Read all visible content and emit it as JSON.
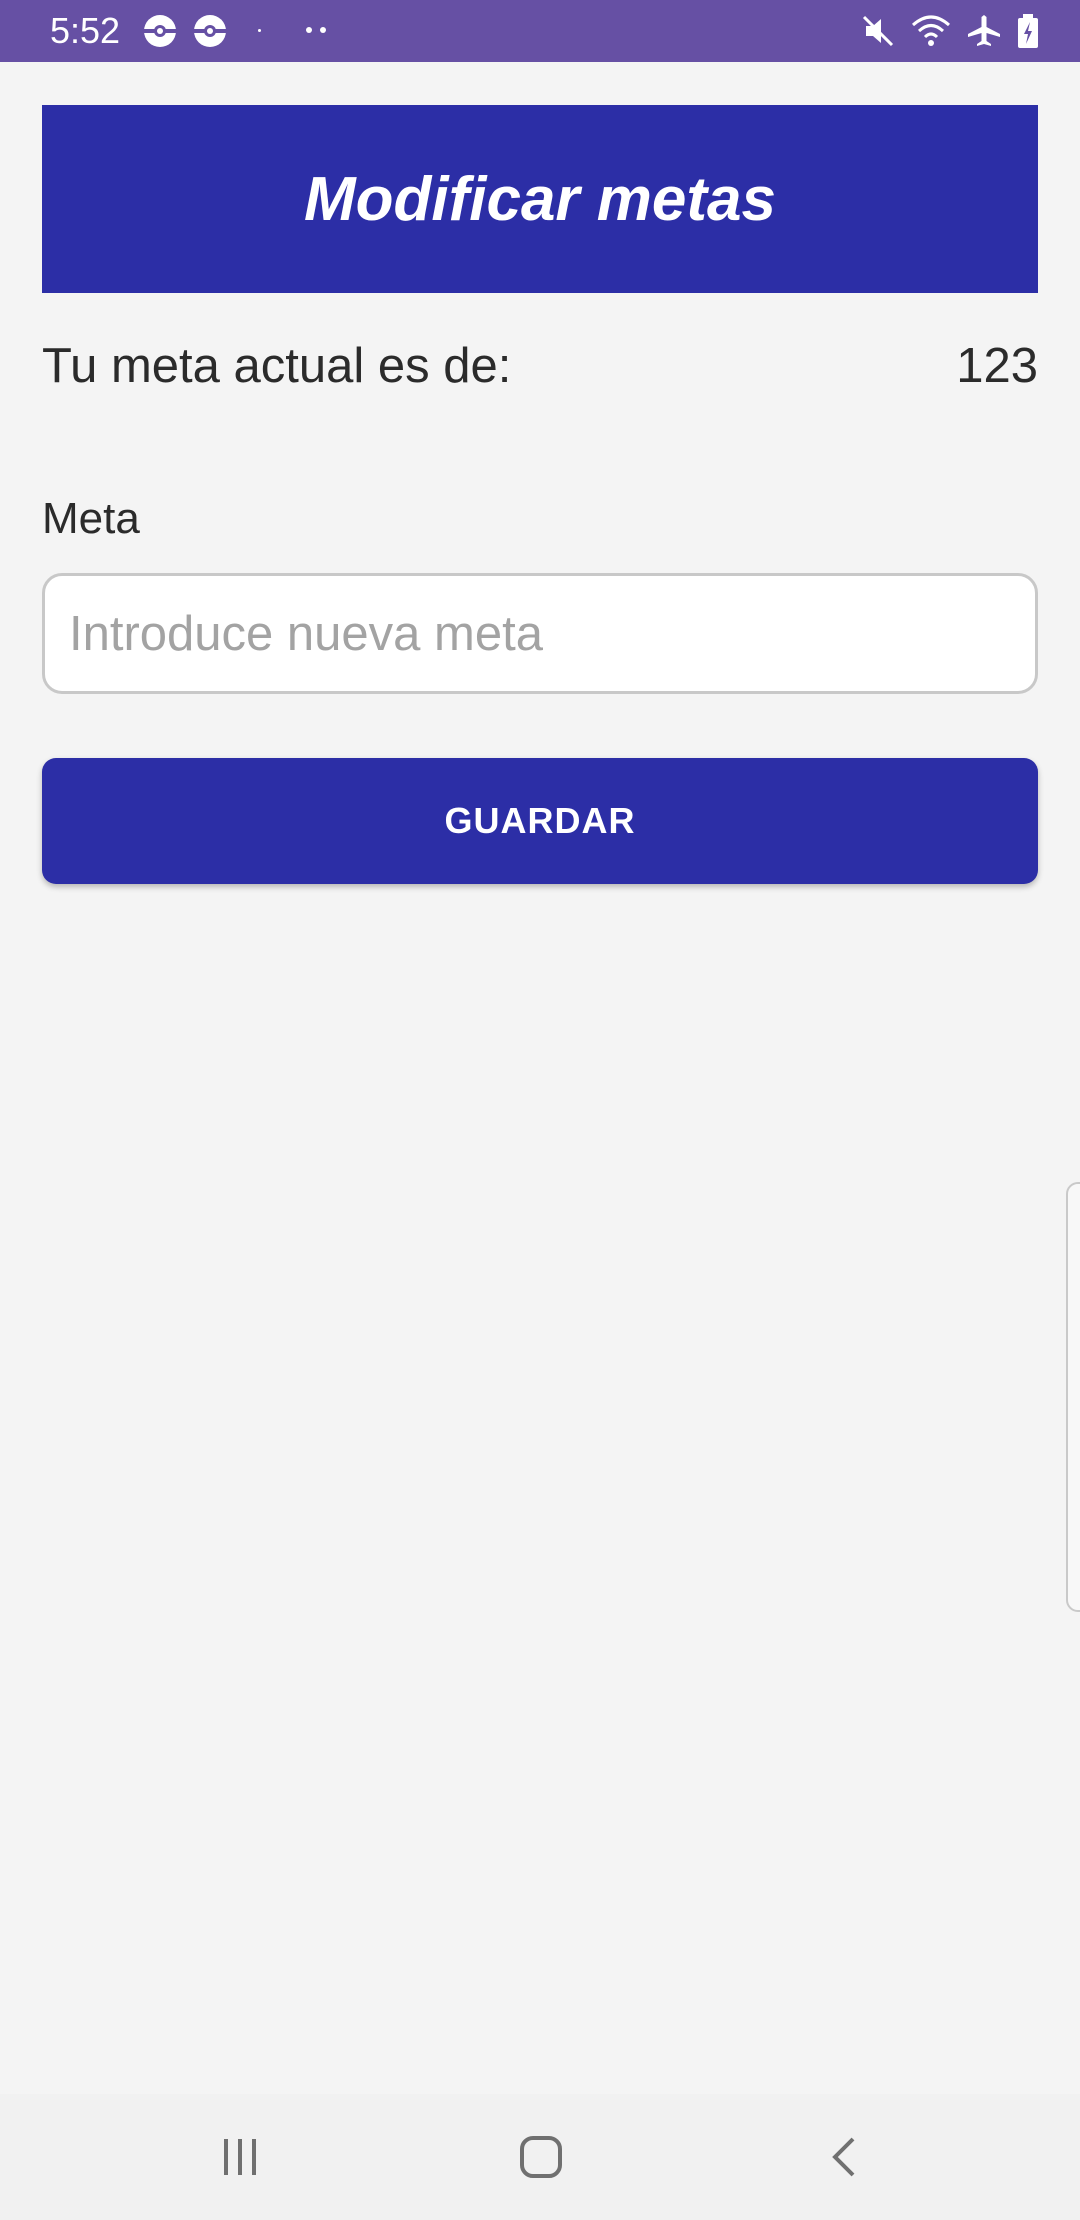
{
  "status_bar": {
    "time": "5:52",
    "icons": [
      "pokeball-icon",
      "pokeball-icon",
      "dots-icon",
      "mute-icon",
      "wifi-icon",
      "airplane-icon",
      "battery-charging-icon"
    ]
  },
  "header": {
    "title": "Modificar metas"
  },
  "current_goal": {
    "label": "Tu meta actual es de:",
    "value": "123"
  },
  "goal_field": {
    "label": "Meta",
    "placeholder": "Introduce nueva meta",
    "value": ""
  },
  "save_button": {
    "label": "GUARDAR"
  },
  "nav_bar": {
    "icons": [
      "recents-icon",
      "home-icon",
      "back-icon"
    ]
  },
  "colors": {
    "accent": "#2c2ea6",
    "status_bar": "#6650a4",
    "background": "#f4f4f4"
  }
}
